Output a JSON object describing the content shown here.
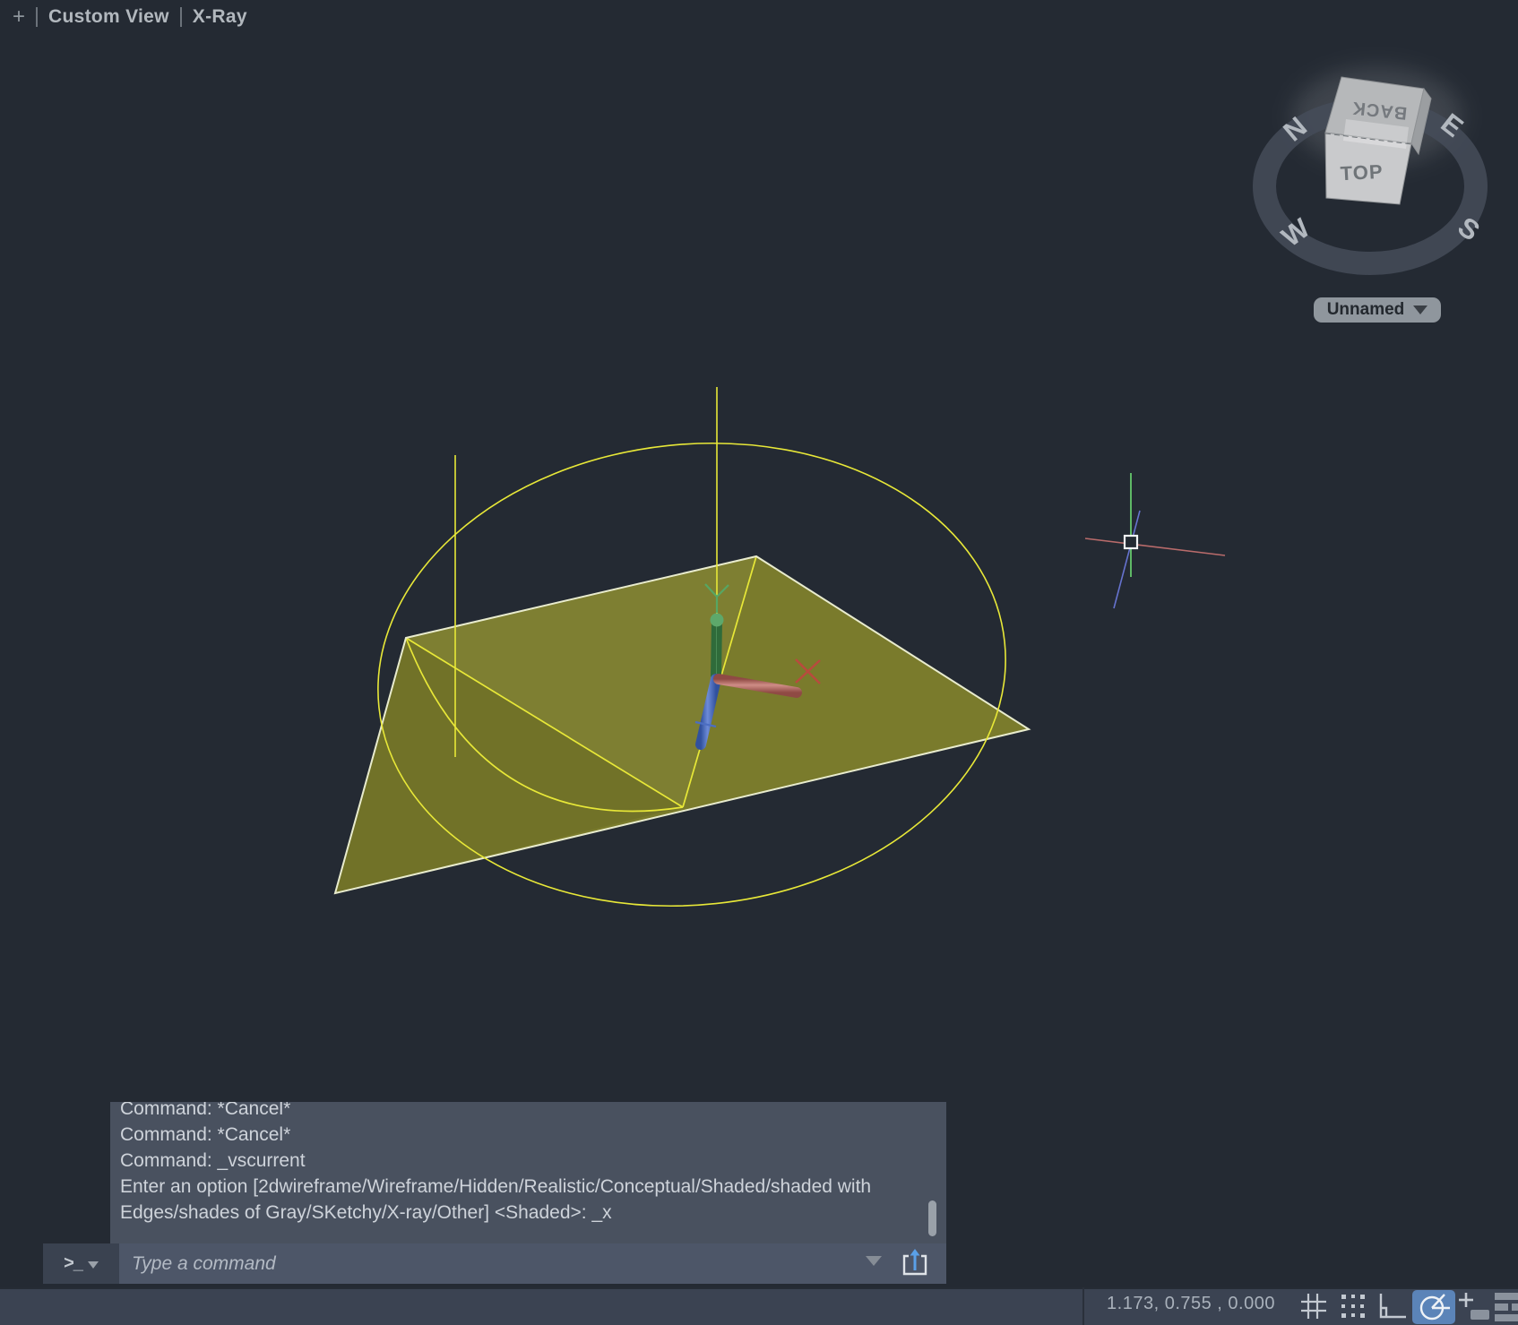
{
  "top_bar": {
    "add_view_label": "+",
    "view_name": "Custom View",
    "visual_style": "X-Ray"
  },
  "viewcube": {
    "top_face": "TOP",
    "back_face": "BACK",
    "compass_n": "N",
    "compass_e": "E",
    "compass_s": "S",
    "compass_w": "W",
    "view_selector": "Unnamed"
  },
  "command_panel": {
    "lines": [
      "Command: *Cancel*",
      "Command: *Cancel*",
      "Command: _vscurrent",
      "Enter an option [2dwireframe/Wireframe/Hidden/Realistic/Conceptual/Shaded/shaded with",
      "Edges/shades of Gray/SKetchy/X-ray/Other] <Shaded>: _x"
    ]
  },
  "command_input": {
    "prompt": ">_",
    "placeholder": "Type a command"
  },
  "status_bar": {
    "coordinates": "1.173,  0.755 , 0.000"
  },
  "colors": {
    "viewport_bg": "#242a33",
    "surface_olive": "#7a7b2c",
    "edge_yellow": "#e8e838",
    "edge_pale": "#e9ecce",
    "axis_green": "#3f8f4d",
    "axis_red": "#bd7a72",
    "axis_blue": "#4c6ec2",
    "active_tool_blue": "#5b84b8",
    "panel_bg": "#49515f"
  }
}
